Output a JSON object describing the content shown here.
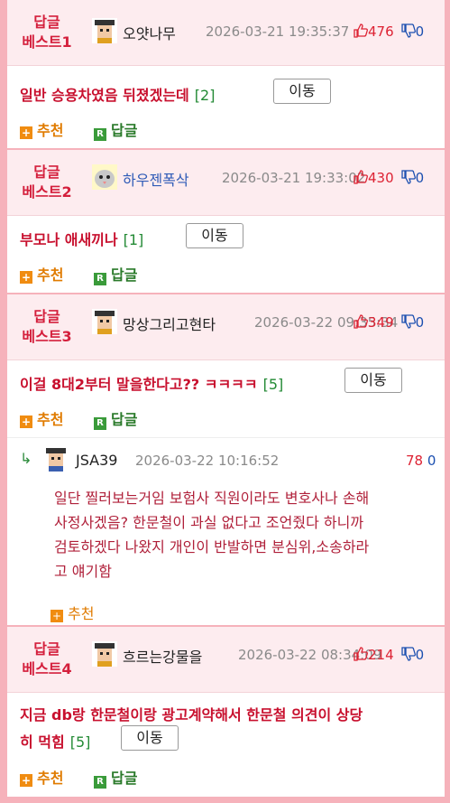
{
  "items": [
    {
      "badge_l1": "답글",
      "badge_l2": "베스트1",
      "nick": "오얏나무",
      "date": "2026-03-21 19:35:37",
      "up": "476",
      "down": "0",
      "title": "일반 승용차였음 뒤졌겠는데",
      "count": "[2]",
      "move": "이동",
      "rec": "추천",
      "rep": "답글"
    },
    {
      "badge_l1": "답글",
      "badge_l2": "베스트2",
      "nick": "하우젠폭삭",
      "date": "2026-03-21 19:33:02",
      "up": "430",
      "down": "0",
      "title": "부모나 애새끼나",
      "count": "[1]",
      "move": "이동",
      "rec": "추천",
      "rep": "답글"
    },
    {
      "badge_l1": "답글",
      "badge_l2": "베스트3",
      "nick": "망상그리고현타",
      "date": "2026-03-22 09:35:34",
      "up": "349",
      "down": "0",
      "title": "이걸 8대2부터 말을한다고?? ㅋㅋㅋㅋ",
      "count": "[5]",
      "move": "이동",
      "rec": "추천",
      "rep": "답글"
    },
    {
      "badge_l1": "답글",
      "badge_l2": "베스트4",
      "nick": "흐르는강물을",
      "date": "2026-03-22 08:34:09",
      "up": "214",
      "down": "0",
      "title_l1": "지금 db랑 한문철이랑 광고계약해서 한문철 의견이 상당",
      "title_l2": "히 먹힘",
      "count": "[5]",
      "move": "이동",
      "rec": "추천",
      "rep": "답글"
    }
  ],
  "reply": {
    "arrow": "↳",
    "nick": "JSA39",
    "date": "2026-03-22 10:16:52",
    "up": "78",
    "down": "0",
    "lines": [
      "일단 찔러보는거임 보험사 직원이라도 변호사나 손해",
      "사정사겠음? 한문철이 과실 없다고 조언줬다 하니까",
      "검토하겠다 나왔지 개인이 반발하면 분심위,소송하라",
      "고 얘기함"
    ],
    "rec": "추천"
  },
  "icons": {
    "thumb_up": "thumb-up-icon",
    "thumb_down": "thumb-down-icon",
    "recommend": "plus-icon",
    "reply": "reply-r-icon"
  }
}
